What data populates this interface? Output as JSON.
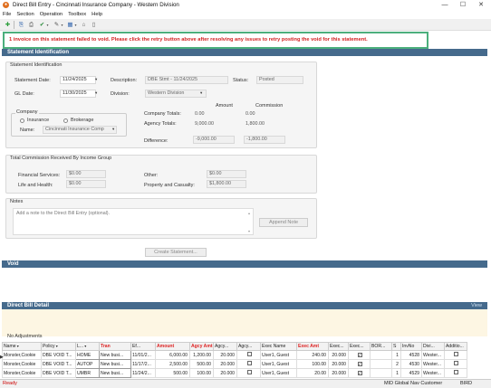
{
  "window": {
    "title": "Direct Bill Entry - Cincinnati Insurance Company - Western Division",
    "minimize": "—",
    "maximize": "☐",
    "close": "✕",
    "app_icon": "app-logo-icon"
  },
  "menu": [
    "File",
    "Section",
    "Operation",
    "Toolbox",
    "Help"
  ],
  "toolbar": {
    "icons": [
      "add-icon",
      "save-icon",
      "print-icon",
      "check-icon",
      "dropdown-icon",
      "edit-icon",
      "dropdown-icon",
      "grid-icon",
      "dropdown-icon",
      "scan-icon",
      "document-icon"
    ]
  },
  "alert": "1 invoice on this statement failed to void. Please click the retry button above after resolving any issues to retry posting the void for this statement.",
  "sections": {
    "statement": "Statement Identification",
    "void": "Void",
    "detail": "Direct Bill Detail",
    "detail_view": "View"
  },
  "statement": {
    "group_label": "Statement Identification",
    "statement_date_label": "Statement Date:",
    "statement_date": "11/24/2025",
    "gl_date_label": "GL Date:",
    "gl_date": "11/30/2025",
    "description_label": "Description:",
    "description": "DBE Stmt - 11/24/2025",
    "status_label": "Status:",
    "status": "Posted",
    "division_label": "Division:",
    "division": "Western Division",
    "company_label": "Company",
    "insurance_label": "Insurance",
    "brokerage_label": "Brokerage",
    "name_label": "Name:",
    "name": "Cincinnati Insurance Comp",
    "amount_header": "Amount",
    "commission_header": "Commission",
    "company_totals_label": "Company Totals:",
    "company_total_amount": "0.00",
    "company_total_commission": "0.00",
    "agency_totals_label": "Agency Totals:",
    "agency_total_amount": "9,000.00",
    "agency_total_commission": "1,800.00",
    "difference_label": "Difference:",
    "difference_amount": "-9,000.00",
    "difference_commission": "-1,800.00"
  },
  "income": {
    "group_label": "Total Commission Received By Income Group",
    "financial_label": "Financial Services:",
    "financial": "$0.00",
    "life_label": "Life and Health:",
    "life": "$0.00",
    "other_label": "Other:",
    "other": "$0.00",
    "property_label": "Property and Casualty:",
    "property": "$1,800.00"
  },
  "notes": {
    "label": "Notes",
    "placeholder": "Add a note to the Direct Bill Entry (optional).",
    "append_button": "Append Note"
  },
  "create_statement_button": "Create Statement...",
  "adjustments": "No Adjustments",
  "grid": {
    "columns": [
      {
        "label": "Name",
        "red": false,
        "filter": true
      },
      {
        "label": "Policy",
        "red": false,
        "filter": true
      },
      {
        "label": "L...",
        "red": false,
        "filter": true
      },
      {
        "label": "Tran",
        "red": true,
        "filter": false
      },
      {
        "label": "Ef...",
        "red": false,
        "filter": false
      },
      {
        "label": "Amount",
        "red": true,
        "filter": false
      },
      {
        "label": "Agcy Amt",
        "red": true,
        "filter": false
      },
      {
        "label": "Agcy...",
        "red": false,
        "filter": false
      },
      {
        "label": "Agcy...",
        "red": false,
        "filter": false
      },
      {
        "label": "Exec Name",
        "red": false,
        "filter": false
      },
      {
        "label": "Exec Amt",
        "red": true,
        "filter": false
      },
      {
        "label": "Exec...",
        "red": false,
        "filter": false
      },
      {
        "label": "Exec...",
        "red": false,
        "filter": false
      },
      {
        "label": "BOR...",
        "red": false,
        "filter": false
      },
      {
        "label": "S",
        "red": false,
        "filter": false
      },
      {
        "label": "InvNo",
        "red": false,
        "filter": false
      },
      {
        "label": "Divi...",
        "red": false,
        "filter": false
      },
      {
        "label": "Additio...",
        "red": false,
        "filter": false
      }
    ],
    "rows": [
      {
        "name": "Monster,Cookie",
        "policy": "DBE VOID T...",
        "line": "HOME",
        "tran": "New busi...",
        "eff": "11/01/2...",
        "amount": "6,000.00",
        "agcy_amt": "1,200.00",
        "agcy_pct": "20.000",
        "exec_name": "User1, Guest",
        "exec_amt": "240.00",
        "exec_pct": "20.000",
        "exec_chk": true,
        "s": "1",
        "invno": "4528",
        "div": "Wester..."
      },
      {
        "name": "Monster,Cookie",
        "policy": "DBE VOID T...",
        "line": "AUTOP",
        "tran": "New busi...",
        "eff": "11/17/2...",
        "amount": "2,500.00",
        "agcy_amt": "500.00",
        "agcy_pct": "20.000",
        "exec_name": "User1, Guest",
        "exec_amt": "100.00",
        "exec_pct": "20.000",
        "exec_chk": true,
        "s": "2",
        "invno": "4530",
        "div": "Wester..."
      },
      {
        "name": "Monster,Cookie",
        "policy": "DBE VOID T...",
        "line": "UMBR",
        "tran": "New busi...",
        "eff": "11/24/2...",
        "amount": "500.00",
        "agcy_amt": "100.00",
        "agcy_pct": "20.000",
        "exec_name": "User1, Guest",
        "exec_amt": "20.00",
        "exec_pct": "20.000",
        "exec_chk": true,
        "s": "1",
        "invno": "4529",
        "div": "Wester..."
      }
    ]
  },
  "status_bar": {
    "left": "Ready",
    "customer": "MID Global Nav Customer",
    "user": "BIRD"
  }
}
